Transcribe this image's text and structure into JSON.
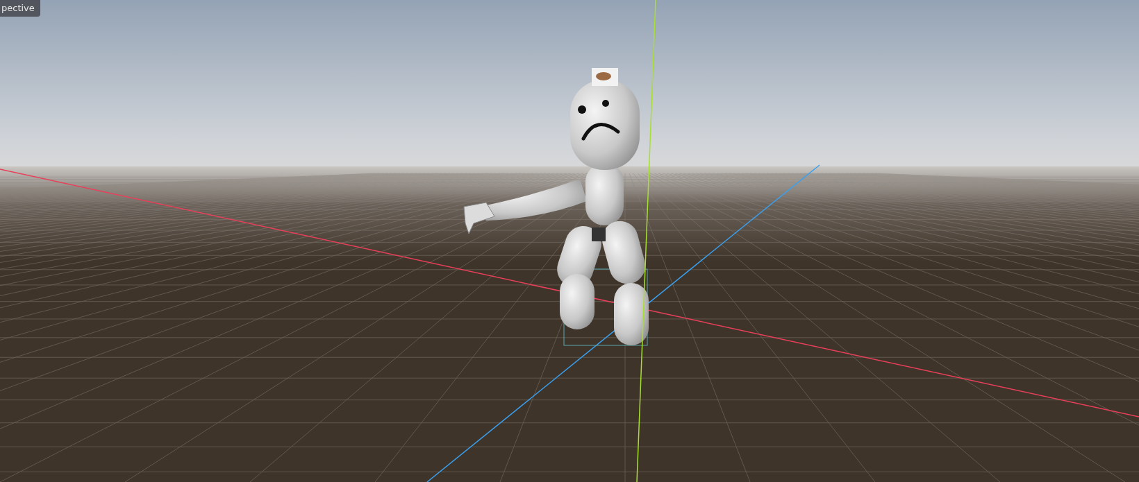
{
  "viewport": {
    "view_label": "pective"
  }
}
